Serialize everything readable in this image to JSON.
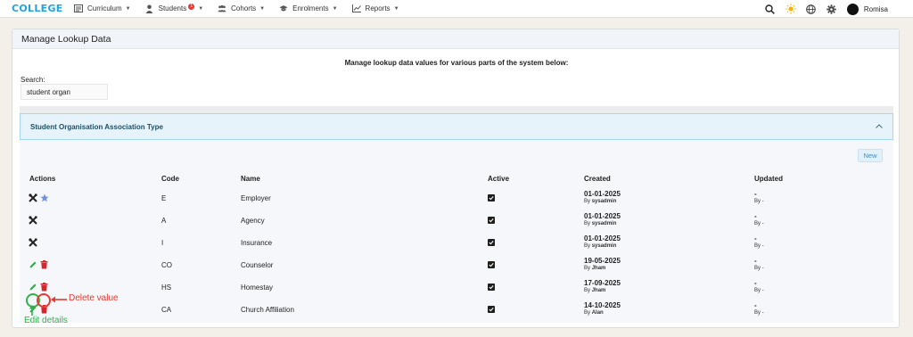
{
  "nav": {
    "brand": "COLLEGE",
    "items": [
      {
        "label": "Curriculum",
        "icon": "book-icon"
      },
      {
        "label": "Students",
        "icon": "student-icon",
        "badge": "1"
      },
      {
        "label": "Cohorts",
        "icon": "users-icon"
      },
      {
        "label": "Enrolments",
        "icon": "graduation-cap-icon"
      },
      {
        "label": "Reports",
        "icon": "chart-icon"
      }
    ],
    "user": "Romisa"
  },
  "page": {
    "title": "Manage Lookup Data",
    "intro": "Manage lookup data values for various parts of the system below:",
    "search_label": "Search:",
    "search_value": "student organ"
  },
  "section": {
    "title": "Student Organisation Association Type",
    "new_label": "New",
    "columns": [
      "Actions",
      "Code",
      "Name",
      "Active",
      "Created",
      "Updated"
    ],
    "rows": [
      {
        "code": "E",
        "name": "Employer",
        "created": "01-01-2025",
        "created_by_prefix": "By",
        "created_by": "sysadmin",
        "updated": "-",
        "updated_by": "By -"
      },
      {
        "code": "A",
        "name": "Agency",
        "created": "01-01-2025",
        "created_by_prefix": "By",
        "created_by": "sysadmin",
        "updated": "-",
        "updated_by": "By -"
      },
      {
        "code": "I",
        "name": "Insurance",
        "created": "01-01-2025",
        "created_by_prefix": "By",
        "created_by": "sysadmin",
        "updated": "-",
        "updated_by": "By -"
      },
      {
        "code": "CO",
        "name": "Counselor",
        "created": "19-05-2025",
        "created_by_prefix": "By",
        "created_by": "Jham",
        "updated": "-",
        "updated_by": "By -"
      },
      {
        "code": "HS",
        "name": "Homestay",
        "created": "17-09-2025",
        "created_by_prefix": "By",
        "created_by": "Jham",
        "updated": "-",
        "updated_by": "By -"
      },
      {
        "code": "CA",
        "name": "Church Affiliation",
        "created": "14-10-2025",
        "created_by_prefix": "By",
        "created_by": "Alan",
        "updated": "-",
        "updated_by": "By -"
      }
    ]
  },
  "annotations": {
    "delete": "Delete value",
    "edit": "Edit details"
  },
  "colors": {
    "brand": "#22a3dd",
    "edit": "#2ea84a",
    "delete": "#d9262c",
    "annotation_red": "#e53935",
    "annotation_green": "#2eb34a"
  }
}
